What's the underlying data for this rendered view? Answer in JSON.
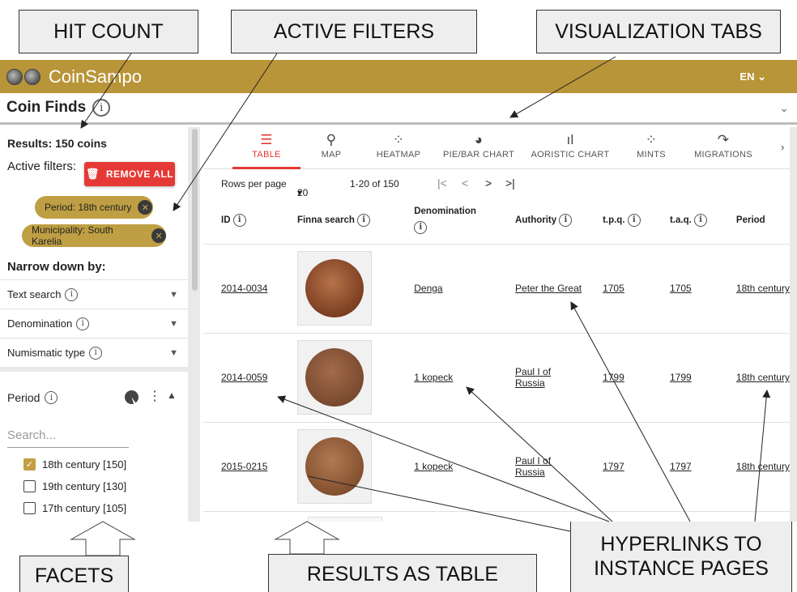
{
  "callouts": {
    "hit_count": "HIT COUNT",
    "active_filters": "ACTIVE FILTERS",
    "visualization_tabs": "VISUALIZATION TABS",
    "facets": "FACETS",
    "results_as_table": "RESULTS AS TABLE",
    "hyperlinks_line1": "HYPERLINKS TO",
    "hyperlinks_line2": "INSTANCE PAGES"
  },
  "appbar": {
    "brand": "CoinSampo",
    "language": "EN",
    "color": "#b99539"
  },
  "header": {
    "title": "Coin Finds"
  },
  "sidebar": {
    "results": "Results: 150 coins",
    "active_filters_label": "Active filters:",
    "remove_all": "REMOVE ALL",
    "chips": [
      "Period: 18th century",
      "Municipality: South Karelia"
    ],
    "narrow_label": "Narrow down by:",
    "facets": [
      "Text search",
      "Denomination",
      "Numismatic type"
    ],
    "period": {
      "label": "Period",
      "search_placeholder": "Search...",
      "options": [
        {
          "label": "18th century [150]",
          "checked": true
        },
        {
          "label": "19th century [130]",
          "checked": false
        },
        {
          "label": "17th century [105]",
          "checked": false
        }
      ]
    }
  },
  "tabs": [
    "TABLE",
    "MAP",
    "HEATMAP",
    "PIE/BAR CHART",
    "AORISTIC CHART",
    "MINTS",
    "MIGRATIONS"
  ],
  "pager": {
    "rows_label": "Rows per page",
    "rows_value": "20",
    "range": "1-20 of 150"
  },
  "table": {
    "headers": [
      "ID",
      "Finna search",
      "Denomination",
      "Authority",
      "t.p.q.",
      "t.a.q.",
      "Period"
    ],
    "rows": [
      {
        "id": "2014-0034",
        "denomination": "Denga",
        "authority": "Peter the Great",
        "tpq": "1705",
        "taq": "1705",
        "period": "18th century"
      },
      {
        "id": "2014-0059",
        "denomination": "1 kopeck",
        "authority": "Paul I of Russia",
        "tpq": "1799",
        "taq": "1799",
        "period": "18th century"
      },
      {
        "id": "2015-0215",
        "denomination": "1 kopeck",
        "authority": "Paul I of Russia",
        "tpq": "1797",
        "taq": "1797",
        "period": "18th century"
      }
    ]
  },
  "colors": {
    "accent": "#e53935",
    "chip": "#bf9f44"
  }
}
